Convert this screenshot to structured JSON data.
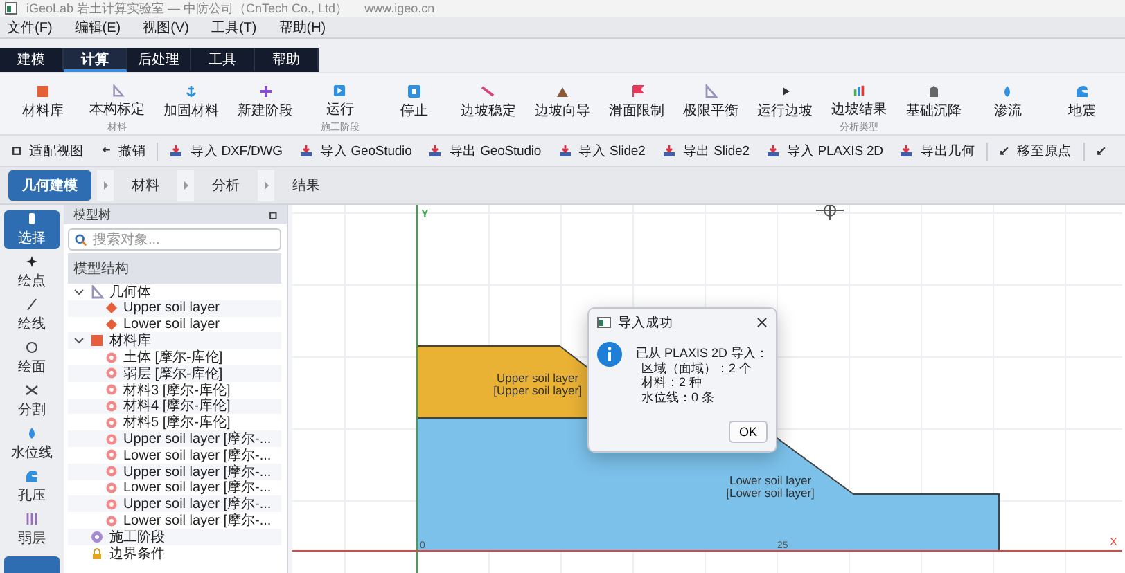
{
  "window": {
    "title": "iGeoLab 岩土计算实验室 — 中防公司（CnTech Co., Ltd）",
    "url": "www.igeo.cn"
  },
  "menu": [
    "文件(F)",
    "编辑(E)",
    "视图(V)",
    "工具(T)",
    "帮助(H)"
  ],
  "ribbon_tabs": [
    {
      "label": "建模",
      "selected": false
    },
    {
      "label": "计算",
      "selected": true
    },
    {
      "label": "后处理",
      "selected": false
    },
    {
      "label": "工具",
      "selected": false
    },
    {
      "label": "帮助",
      "selected": false
    }
  ],
  "ribbon_buttons": [
    {
      "label": "材料库"
    },
    {
      "label": "本构标定",
      "group_label": "材料"
    },
    {
      "label": "加固材料"
    },
    {
      "label": "新建阶段"
    },
    {
      "label": "运行",
      "group_label": "施工阶段"
    },
    {
      "label": "停止"
    },
    {
      "label": "边坡稳定"
    },
    {
      "label": "边坡向导"
    },
    {
      "label": "滑面限制"
    },
    {
      "label": "极限平衡"
    },
    {
      "label": "运行边坡"
    },
    {
      "label": "边坡结果",
      "group_label": "分析类型"
    },
    {
      "label": "基础沉降"
    },
    {
      "label": "渗流"
    },
    {
      "label": "地震"
    }
  ],
  "toolbar": {
    "groups": [
      [
        "适配视图",
        "撤销"
      ],
      [
        "导入 DXF/DWG",
        "导入 GeoStudio",
        "导出 GeoStudio",
        "导入 Slide2",
        "导出 Slide2",
        "导入 PLAXIS 2D",
        "导出几何"
      ],
      [
        "移至原点"
      ]
    ]
  },
  "workflow_steps": [
    {
      "label": "几何建模",
      "selected": true
    },
    {
      "label": "材料",
      "selected": false
    },
    {
      "label": "分析",
      "selected": false
    },
    {
      "label": "结果",
      "selected": false
    }
  ],
  "tools": [
    {
      "label": "选择",
      "selected": true
    },
    {
      "label": "绘点",
      "selected": false
    },
    {
      "label": "绘线",
      "selected": false
    },
    {
      "label": "绘面",
      "selected": false
    },
    {
      "label": "分割",
      "selected": false
    },
    {
      "label": "水位线",
      "selected": false
    },
    {
      "label": "孔压",
      "selected": false
    },
    {
      "label": "弱层",
      "selected": false
    }
  ],
  "model_tree": {
    "title": "模型树",
    "search": {
      "placeholder": "搜索对象..."
    },
    "header": "模型结构",
    "items": [
      {
        "label": "几何体",
        "expanded": true,
        "children": [
          {
            "label": "Upper soil layer"
          },
          {
            "label": "Lower soil layer"
          }
        ]
      },
      {
        "label": "材料库",
        "expanded": true,
        "children": [
          {
            "label": "土体 [摩尔-库伦]"
          },
          {
            "label": "弱层 [摩尔-库伦]"
          },
          {
            "label": "材料3 [摩尔-库伦]"
          },
          {
            "label": "材料4 [摩尔-库伦]"
          },
          {
            "label": "材料5 [摩尔-库伦]"
          },
          {
            "label": "Upper soil layer [摩尔-..."
          },
          {
            "label": "Lower soil layer [摩尔-..."
          },
          {
            "label": "Upper soil layer [摩尔-..."
          },
          {
            "label": "Lower soil layer [摩尔-..."
          },
          {
            "label": "Upper soil layer [摩尔-..."
          },
          {
            "label": "Lower soil layer [摩尔-..."
          }
        ]
      },
      {
        "label": "施工阶段"
      },
      {
        "label": "边界条件"
      }
    ]
  },
  "canvas": {
    "y_axis_label": "Y",
    "x_axis_label": "X",
    "x_ticks": [
      "0",
      "25"
    ],
    "regions": [
      {
        "name": "Upper soil layer",
        "material": "[Upper soil layer]",
        "color": "#e9b235"
      },
      {
        "name": "Lower soil layer",
        "material": "[Lower soil layer]",
        "color": "#7cc1ea"
      }
    ]
  },
  "dialog": {
    "title": "导入成功",
    "lines": [
      "已从 PLAXIS 2D 导入：",
      "区域（面域）：2 个",
      "材料：2 种",
      "水位线：0 条"
    ],
    "button": "OK"
  }
}
